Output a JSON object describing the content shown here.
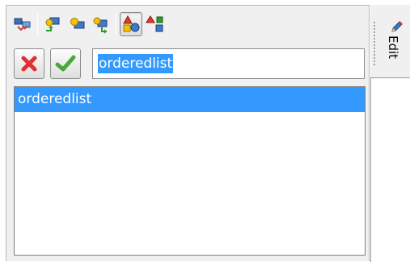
{
  "toolbar": {
    "icons": [
      "arrange-icon",
      "arrow-up-icon",
      "bulb-icon",
      "arrow-down-icon",
      "shapes-view-icon",
      "shapes-replace-icon"
    ]
  },
  "actions": {
    "cancel_icon": "red-x-icon",
    "confirm_icon": "green-check-icon"
  },
  "name_input": {
    "value": "orderedlist"
  },
  "list": {
    "items": [
      {
        "label": "orderedlist",
        "selected": true
      }
    ]
  },
  "side_tab": {
    "label": "Edit",
    "icon": "pencil-icon"
  },
  "colors": {
    "selection": "#3399ff",
    "panel_bg": "#f0f0f0",
    "cancel_red": "#e03030",
    "confirm_green": "#4aa83a"
  }
}
